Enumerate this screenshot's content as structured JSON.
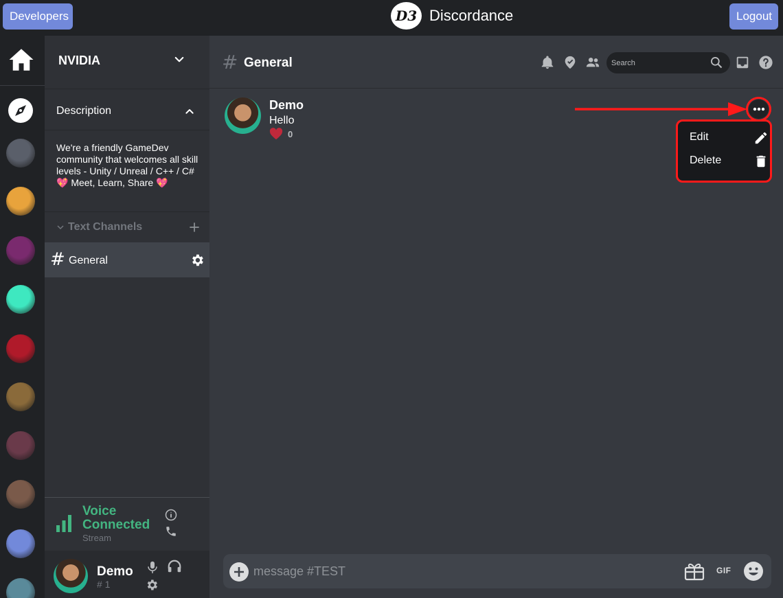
{
  "topbar": {
    "developers_label": "Developers",
    "logout_label": "Logout",
    "brand_logo": "D3",
    "brand_name": "Discordance"
  },
  "rail": {
    "icons": [
      "home-icon",
      "explore-compass-icon"
    ],
    "servers": [
      {
        "name": "server-1",
        "color": "#5a5f6a"
      },
      {
        "name": "server-2",
        "color": "#e8a33c"
      },
      {
        "name": "server-3",
        "color": "#7a2a6e"
      },
      {
        "name": "server-4",
        "color": "#3ee8c0"
      },
      {
        "name": "server-5",
        "color": "#b01a2a"
      },
      {
        "name": "server-6",
        "color": "#8a6a3a"
      },
      {
        "name": "server-7",
        "color": "#6a3a4a"
      },
      {
        "name": "server-8",
        "color": "#7a5a4a"
      },
      {
        "name": "server-9",
        "color": "#7289da"
      },
      {
        "name": "server-10",
        "color": "#5a8a9a"
      }
    ]
  },
  "sidebar": {
    "server_name": "NVIDIA",
    "description_title": "Description",
    "description_text": "We're a friendly GameDev community that welcomes all skill levels - Unity / Unreal / C++ / C# 💖 Meet, Learn, Share 💖",
    "text_channels_header": "Text Channels",
    "channels": [
      {
        "hash": "#",
        "label": "General",
        "active": true
      }
    ],
    "voice": {
      "status": "Voice Connected",
      "sub": "Stream"
    },
    "user": {
      "name": "Demo",
      "tag": "# 1"
    }
  },
  "main": {
    "channel_hash": "#",
    "channel_title": "General",
    "search_placeholder": "Search",
    "message": {
      "author": "Demo",
      "text": "Hello",
      "reaction_count": "0"
    },
    "menu": {
      "edit_label": "Edit",
      "delete_label": "Delete"
    },
    "composer": {
      "placeholder": "message #TEST",
      "gif_label": "GIF"
    }
  },
  "colors": {
    "accent": "#7289da",
    "voice_green": "#43b581",
    "annotation_red": "#ff1a1a",
    "heart": "#c0293b"
  }
}
